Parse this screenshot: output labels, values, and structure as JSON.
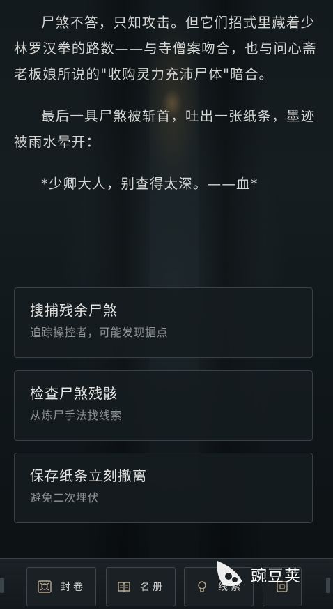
{
  "story": {
    "paragraphs": [
      "尸煞不答，只知攻击。但它们招式里藏着少林罗汉拳的路数——与寺僧案吻合，也与问心斋老板娘所说的\"收购灵力充沛尸体\"暗合。",
      "最后一具尸煞被斩首，吐出一张纸条，墨迹被雨水晕开：",
      "*少卿大人，别查得太深。——血*"
    ]
  },
  "choices": [
    {
      "title": "搜捕残余尸煞",
      "desc": "追踪操控者，可能发现据点"
    },
    {
      "title": "检查尸煞残骸",
      "desc": "从炼尸手法找线索"
    },
    {
      "title": "保存纸条立刻撤离",
      "desc": "避免二次埋伏"
    }
  ],
  "nav": [
    {
      "label": "封卷",
      "icon": "scroll-icon"
    },
    {
      "label": "名册",
      "icon": "book-icon"
    },
    {
      "label": "线索",
      "icon": "bulb-icon"
    },
    {
      "label": "",
      "icon": "box-icon"
    }
  ],
  "watermark": {
    "text": "豌豆荚"
  },
  "colors": {
    "text": "#d6d6d4",
    "card": "#161c20",
    "border": "#3a4146",
    "muted": "#8d9396"
  }
}
